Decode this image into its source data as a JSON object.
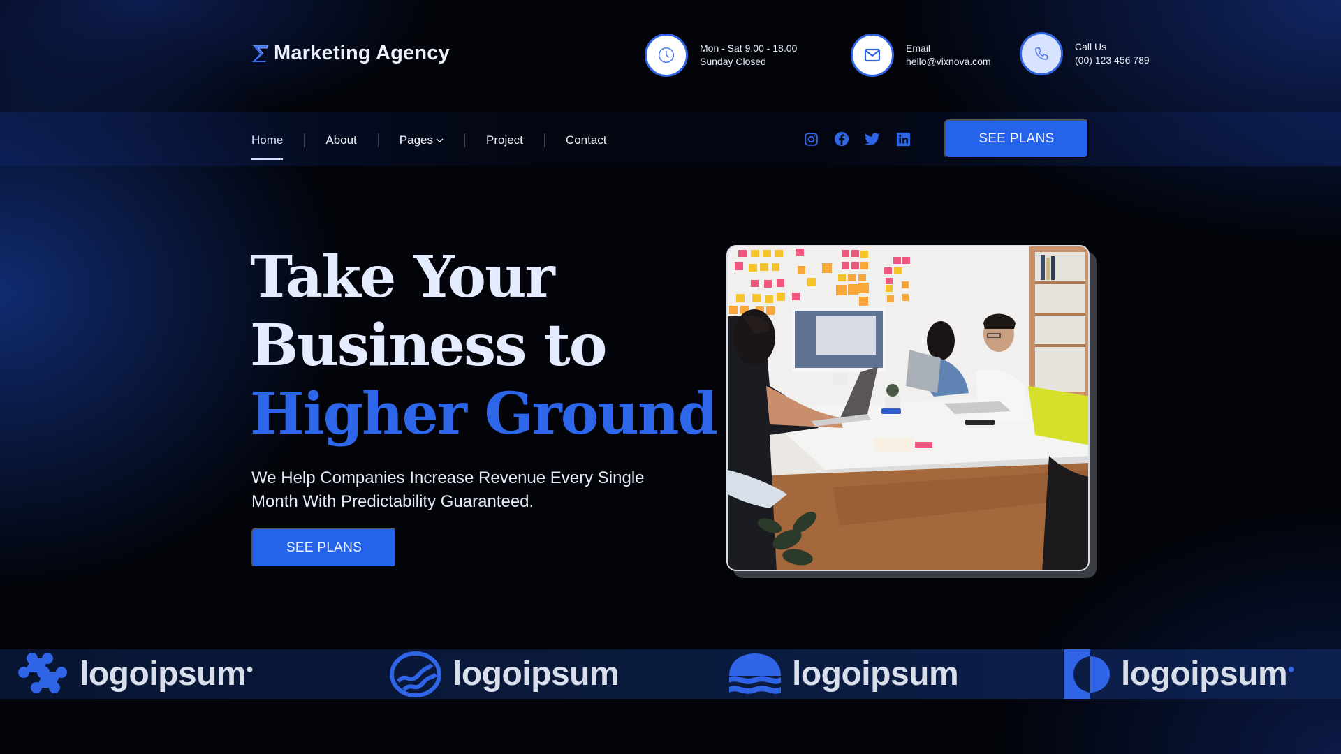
{
  "brand": {
    "name": "Marketing Agency",
    "icon": "sigma-logo-icon"
  },
  "contact_info": [
    {
      "icon": "clock-icon",
      "line1": "Mon - Sat 9.00 - 18.00",
      "line2": "Sunday Closed"
    },
    {
      "icon": "mail-icon",
      "line1": "Email",
      "line2": "hello@vixnova.com"
    },
    {
      "icon": "phone-icon",
      "line1": "Call Us",
      "line2": "(00) 123 456 789"
    }
  ],
  "nav": {
    "items": [
      {
        "label": "Home",
        "active": true
      },
      {
        "label": "About"
      },
      {
        "label": "Pages",
        "has_dropdown": true
      },
      {
        "label": "Project"
      },
      {
        "label": "Contact"
      }
    ],
    "social": [
      "instagram-icon",
      "facebook-icon",
      "twitter-icon",
      "linkedin-icon"
    ],
    "cta_label": "SEE PLANS"
  },
  "hero": {
    "title_line1": "Take Your",
    "title_line2": "Business to",
    "title_line3": "Higher Ground",
    "subtitle": "We Help Companies Increase Revenue Every Single Month With Predictability Guaranteed.",
    "cta_label": "SEE PLANS",
    "image_alt": "Team meeting around a white table with laptops and sticky notes on the wall"
  },
  "partner_logos": [
    {
      "name": "logoipsum",
      "icon": "molecule-logo-icon",
      "dot": true
    },
    {
      "name": "logoipsum",
      "icon": "globe-wave-logo-icon",
      "dot": false
    },
    {
      "name": "logoipsum",
      "icon": "sun-waves-logo-icon",
      "dot": false
    },
    {
      "name": "logoipsum",
      "icon": "half-circle-logo-icon",
      "dot": true
    }
  ],
  "colors": {
    "accent": "#2563eb",
    "heading_blue": "#2d66e8",
    "background": "#02040a"
  }
}
